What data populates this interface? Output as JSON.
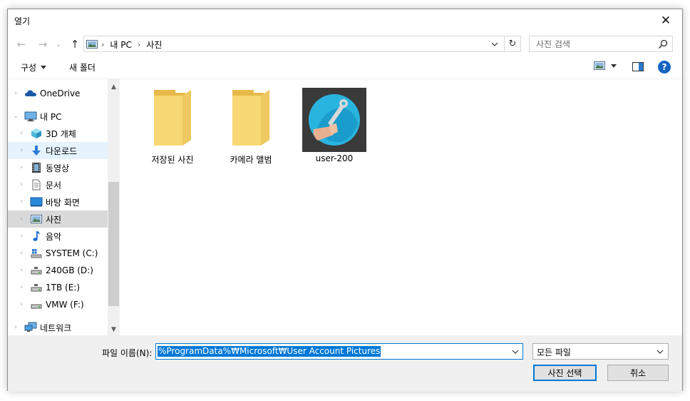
{
  "window": {
    "title": "열기",
    "close_label": "✕"
  },
  "nav": {
    "back": "←",
    "forward": "→",
    "recent": "⌄",
    "up": "↑",
    "breadcrumbs": [
      "내 PC",
      "사진"
    ],
    "refresh": "↻"
  },
  "search": {
    "placeholder": "사진 검색"
  },
  "toolbar": {
    "organize_label": "구성",
    "new_folder_label": "새 폴더",
    "help_label": "?"
  },
  "sidebar": {
    "items": [
      {
        "label": "OneDrive",
        "icon": "cloud-icon"
      },
      {
        "label": "내 PC",
        "icon": "computer-icon"
      },
      {
        "label": "3D 개체",
        "icon": "cube-icon"
      },
      {
        "label": "다운로드",
        "icon": "download-icon"
      },
      {
        "label": "동영상",
        "icon": "film-icon"
      },
      {
        "label": "문서",
        "icon": "document-icon"
      },
      {
        "label": "바탕 화면",
        "icon": "desktop-icon"
      },
      {
        "label": "사진",
        "icon": "pictures-icon"
      },
      {
        "label": "음악",
        "icon": "music-icon"
      },
      {
        "label": "SYSTEM (C:)",
        "icon": "windows-drive-icon"
      },
      {
        "label": "240GB (D:)",
        "icon": "drive-icon"
      },
      {
        "label": "1TB (E:)",
        "icon": "drive-icon"
      },
      {
        "label": "VMW (F:)",
        "icon": "drive-icon"
      },
      {
        "label": "네트워크",
        "icon": "network-icon"
      }
    ]
  },
  "files": [
    {
      "label": "저장된 사진",
      "type": "folder"
    },
    {
      "label": "카메라 앨범",
      "type": "folder"
    },
    {
      "label": "user-200",
      "type": "image"
    }
  ],
  "bottom": {
    "filename_label": "파일 이름(N):",
    "filename_value": "%ProgramData%₩Microsoft₩User Account Pictures",
    "filetype_value": "모든 파일",
    "open_label": "사진 선택",
    "cancel_label": "취소"
  },
  "colors": {
    "accent": "#0078d7",
    "selected": "#d9d9d9",
    "hover": "#e5f3ff",
    "folder": "#f8d775"
  }
}
